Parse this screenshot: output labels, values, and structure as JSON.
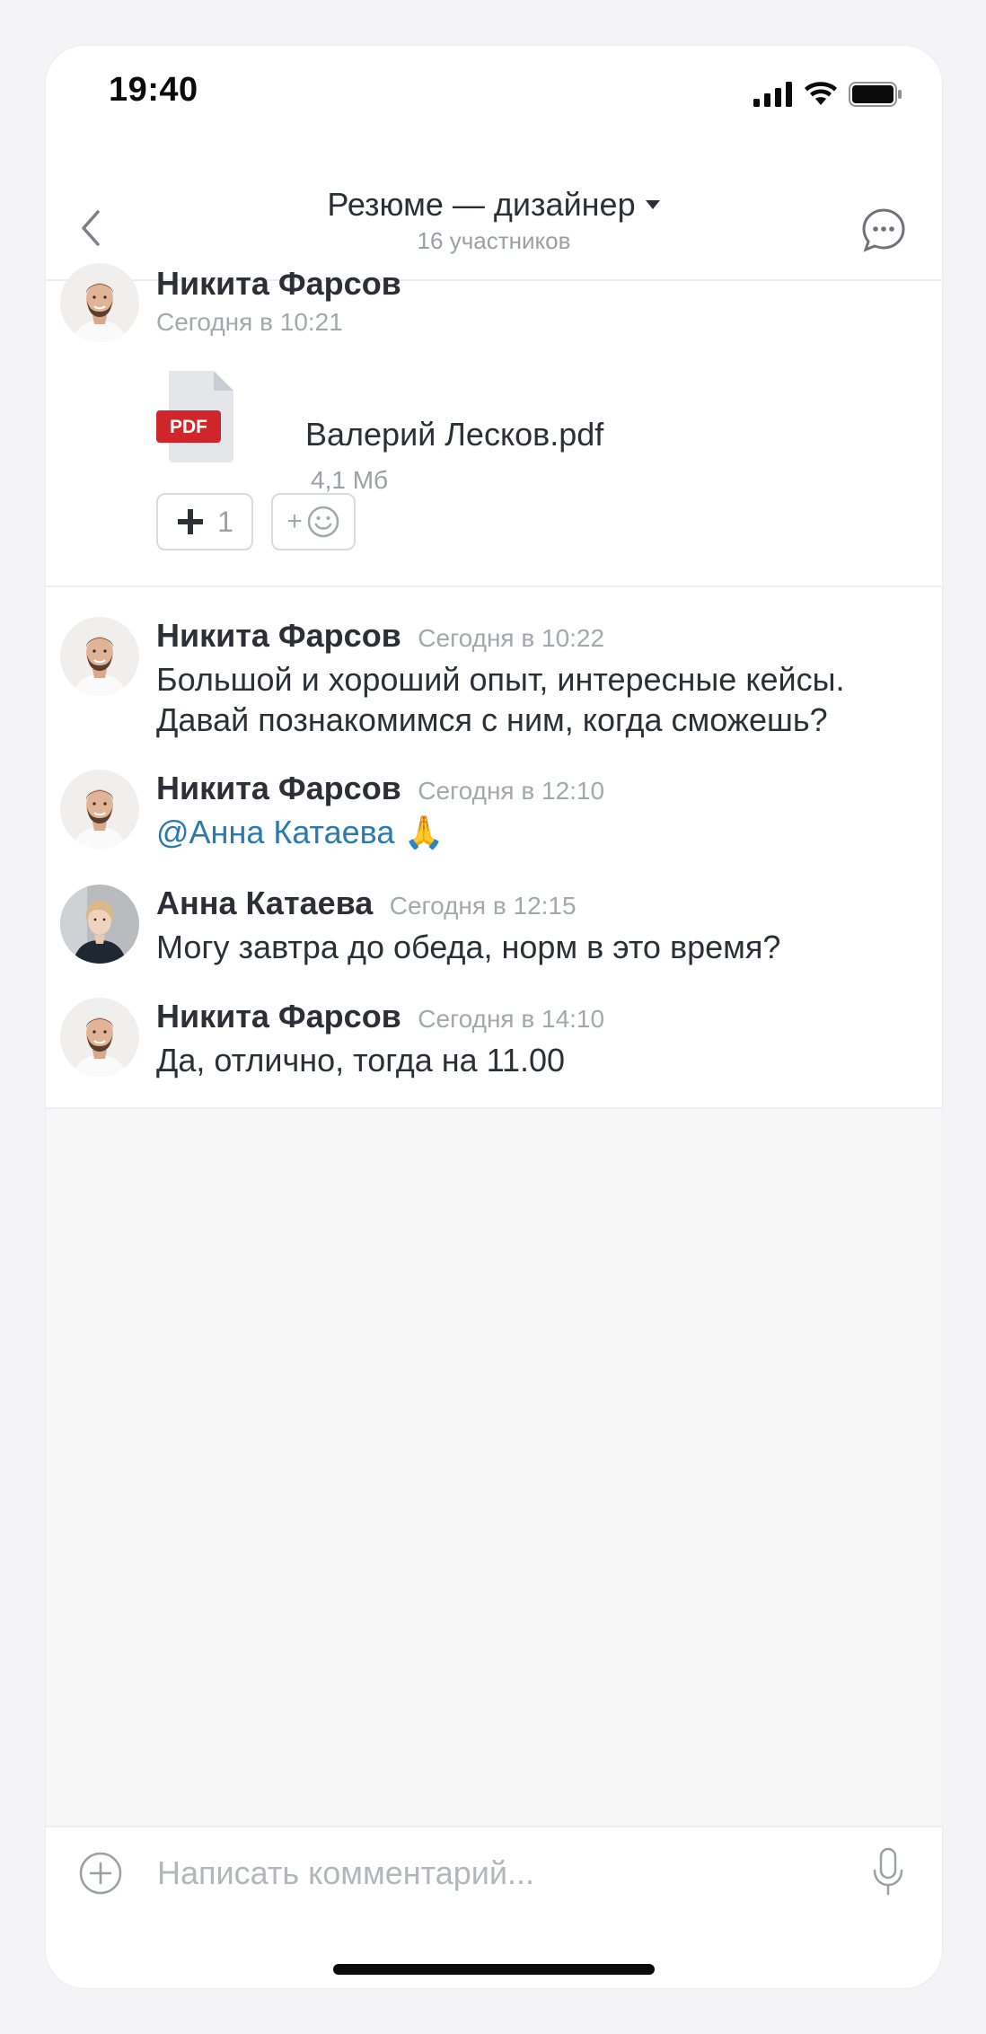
{
  "status": {
    "time": "19:40"
  },
  "header": {
    "title": "Резюме — дизайнер",
    "subtitle": "16 участников"
  },
  "messages": [
    {
      "author": "Никита Фарсов",
      "timestamp": "Сегодня в 10:21",
      "file": {
        "name": "Валерий Лесков.pdf",
        "size": "4,1 Мб",
        "badge": "PDF"
      },
      "reactions": {
        "plus_count": "1",
        "add_emoji": "+"
      }
    },
    {
      "author": "Никита Фарсов",
      "timestamp": "Сегодня в 10:22",
      "text_line1": "Большой и хороший опыт, интересные кейсы.",
      "text_line2": "Давай познакомимся с ним, когда сможешь?"
    },
    {
      "author": "Никита Фарсов",
      "timestamp": "Сегодня в 12:10",
      "mention": "@Анна Катаева",
      "emoji": "🙏"
    },
    {
      "author": "Анна Катаева",
      "timestamp": "Сегодня в 12:15",
      "text": "Могу завтра до обеда, норм в это время?"
    },
    {
      "author": "Никита Фарсов",
      "timestamp": "Сегодня в 14:10",
      "text": "Да, отлично, тогда на 11.00"
    }
  ],
  "composer": {
    "placeholder": "Написать комментарий..."
  },
  "colors": {
    "accent": "#2a7ab0",
    "pdf_badge": "#d0262b",
    "text": "#2c2f36",
    "muted": "#a4a8ad"
  }
}
